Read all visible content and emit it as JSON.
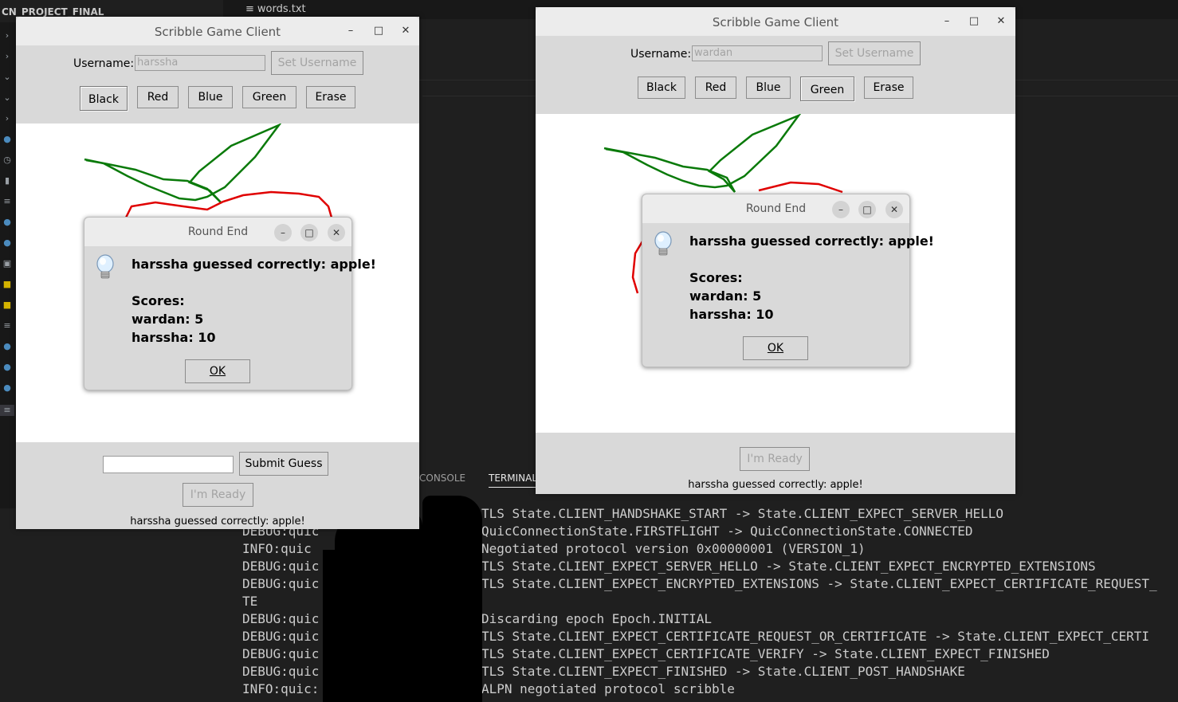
{
  "ide": {
    "explorer_title": "CN_PROJECT_FINAL",
    "open_file_tab": "words.txt",
    "panel_tabs": [
      "CONSOLE",
      "TERMINAL"
    ],
    "terminal_lines": [
      {
        "prefix": "",
        "text": "TLS State.CLIENT_HANDSHAKE_START -> State.CLIENT_EXPECT_SERVER_HELLO"
      },
      {
        "prefix": "DEBUG:quic",
        "text": "QuicConnectionState.FIRSTFLIGHT -> QuicConnectionState.CONNECTED"
      },
      {
        "prefix": "INFO:quic",
        "text": "Negotiated protocol version 0x00000001 (VERSION_1)"
      },
      {
        "prefix": "DEBUG:quic",
        "text": "TLS State.CLIENT_EXPECT_SERVER_HELLO -> State.CLIENT_EXPECT_ENCRYPTED_EXTENSIONS"
      },
      {
        "prefix": "DEBUG:quic",
        "text": "TLS State.CLIENT_EXPECT_ENCRYPTED_EXTENSIONS -> State.CLIENT_EXPECT_CERTIFICATE_REQUEST_"
      },
      {
        "prefix": "TE",
        "text": ""
      },
      {
        "prefix": "DEBUG:quic",
        "text": "Discarding epoch Epoch.INITIAL"
      },
      {
        "prefix": "DEBUG:quic",
        "text": "TLS State.CLIENT_EXPECT_CERTIFICATE_REQUEST_OR_CERTIFICATE -> State.CLIENT_EXPECT_CERTI"
      },
      {
        "prefix": "DEBUG:quic",
        "text": "TLS State.CLIENT_EXPECT_CERTIFICATE_VERIFY -> State.CLIENT_EXPECT_FINISHED"
      },
      {
        "prefix": "DEBUG:quic",
        "text": "TLS State.CLIENT_EXPECT_FINISHED -> State.CLIENT_POST_HANDSHAKE"
      },
      {
        "prefix": "INFO:quic:",
        "text": "ALPN negotiated protocol scribble"
      }
    ]
  },
  "left_client": {
    "title": "Scribble Game Client",
    "username_label": "Username:",
    "username_value": "harssha",
    "set_username_label": "Set Username",
    "colors": [
      "Black",
      "Red",
      "Blue",
      "Green",
      "Erase"
    ],
    "guess_value": "",
    "submit_label": "Submit Guess",
    "ready_label": "I'm Ready",
    "status": "harssha guessed correctly: apple!"
  },
  "right_client": {
    "title": "Scribble Game Client",
    "username_label": "Username:",
    "username_value": "wardan",
    "set_username_label": "Set Username",
    "colors": [
      "Black",
      "Red",
      "Blue",
      "Green",
      "Erase"
    ],
    "ready_label": "I'm Ready",
    "status": "harssha guessed correctly: apple!"
  },
  "dialog": {
    "title": "Round End",
    "headline": "harssha guessed correctly: apple!",
    "scores_label": "Scores:",
    "scores": [
      "wardan: 5",
      "harssha: 10"
    ],
    "ok_label": "OK"
  },
  "stroke_colors": {
    "green": "#0a7a0a",
    "red": "#e00000"
  },
  "window_controls": {
    "minimize": "–",
    "maximize": "□",
    "close": "✕"
  }
}
